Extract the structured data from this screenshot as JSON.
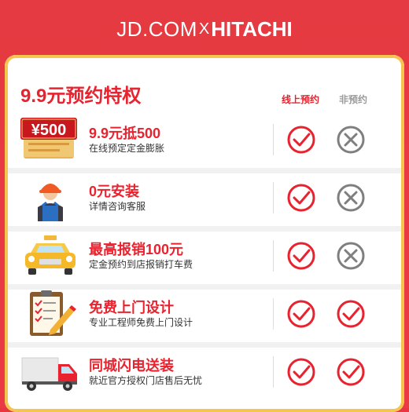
{
  "brand": {
    "left": "JD.COM",
    "separator": "X",
    "right": "HITACHI"
  },
  "header": {
    "title": "9.9元预约特权",
    "col_online": "线上预约",
    "col_offline": "非预约"
  },
  "rows": [
    {
      "title": "9.9元抵500",
      "subtitle": "在线预定定金膨胀",
      "badge": "¥500",
      "icon": "ticket-500-icon",
      "online": "check",
      "offline": "cross"
    },
    {
      "title": "0元安装",
      "subtitle": "详情咨询客服",
      "icon": "installer-worker-icon",
      "online": "check",
      "offline": "cross"
    },
    {
      "title": "最高报销100元",
      "subtitle": "定金预约到店报销打车费",
      "icon": "taxi-icon",
      "online": "check",
      "offline": "cross"
    },
    {
      "title": "免费上门设计",
      "subtitle": "专业工程师免费上门设计",
      "icon": "clipboard-pencil-icon",
      "online": "check",
      "offline": "check"
    },
    {
      "title": "同城闪电送装",
      "subtitle": "就近官方授权门店售后无忧",
      "icon": "delivery-truck-icon",
      "online": "check",
      "offline": "check"
    }
  ],
  "colors": {
    "accent": "#e8232f",
    "card_border": "#f6c54d",
    "gray": "#8a8a8a"
  }
}
